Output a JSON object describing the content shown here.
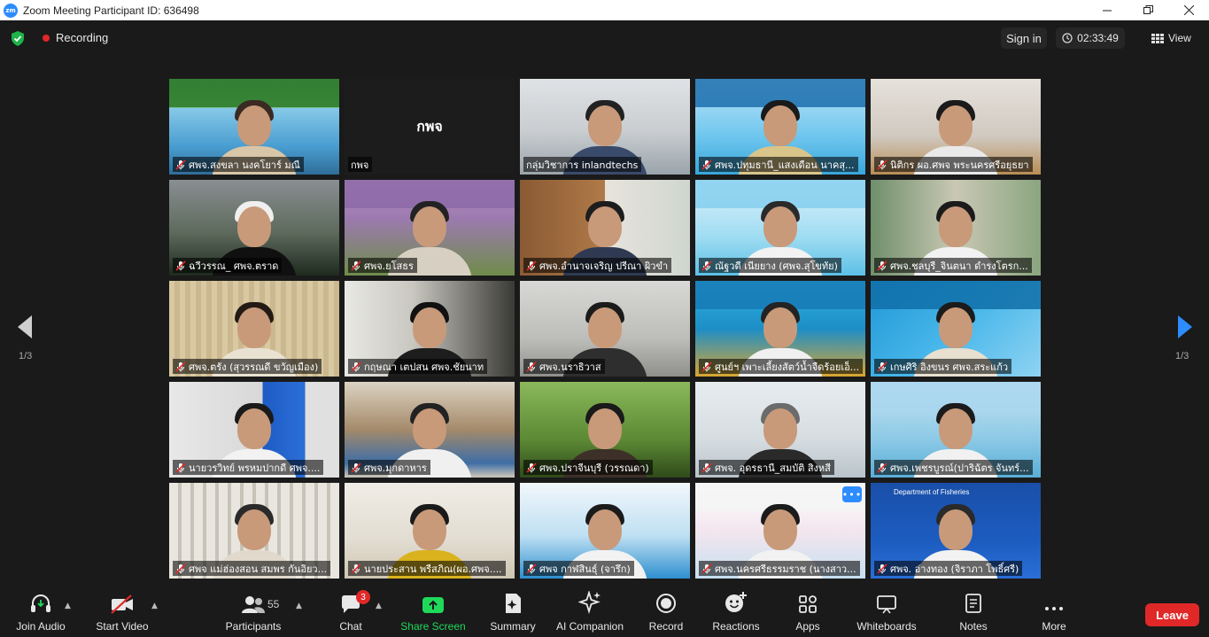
{
  "window": {
    "title": "Zoom Meeting Participant ID: 636498",
    "logo": "zm"
  },
  "topbar": {
    "recording_label": "Recording",
    "sign_in_label": "Sign in",
    "timer": "02:33:49",
    "view_label": "View"
  },
  "gallery": {
    "page_indicator_left": "1/3",
    "page_indicator_right": "1/3",
    "tiles": [
      {
        "name": "ศพจ.สงขลา นงคโยาร์ มณี",
        "muted": true,
        "style": "banner-green"
      },
      {
        "name": "กพจ",
        "muted": false,
        "style": "name-only",
        "center_label": "กพจ"
      },
      {
        "name": "กลุ่มวิชาการ inlandtechs",
        "muted": false,
        "style": "room",
        "active": true
      },
      {
        "name": "ศพจ.ปทุมธานี_แสงเดือน นาคสุ...",
        "muted": true,
        "style": "banner-blue"
      },
      {
        "name": "นิติกร ผอ.ศพจ พระนครศรีอยุธยา",
        "muted": true,
        "style": "man-office"
      },
      {
        "name": "ฉวีวรรณ_ ศพจ.ตราด",
        "muted": true,
        "style": "outdoor-dark"
      },
      {
        "name": "ศพจ.ยโสธร",
        "muted": true,
        "style": "banner-purple"
      },
      {
        "name": "ศพจ.อำนาจเจริญ ปรีณา ผิวขำ",
        "muted": true,
        "style": "office-wood"
      },
      {
        "name": "ณัฐวดี เนียยาง (ศพจ.สุโขทัย)",
        "muted": true,
        "style": "banner-sun"
      },
      {
        "name": "ศพจ.ชลบุรี_จินตนา ดำรงโตรก...",
        "muted": true,
        "style": "blur-green"
      },
      {
        "name": "ศพจ.ตรัง (สุวรรณดี ขวัญเมือง)",
        "muted": true,
        "style": "blinds"
      },
      {
        "name": "กฤษณา เตปสน ศพจ.ชัยนาท",
        "muted": true,
        "style": "dark-room"
      },
      {
        "name": "ศพจ.นราธิวาส",
        "muted": true,
        "style": "blur-grey"
      },
      {
        "name": "ศูนย์ฯ เพาะเลี้ยงสัตว์น้ำจืดร้อยเอ็...",
        "muted": true,
        "style": "banner-teal"
      },
      {
        "name": "เกษศิริ อิงขนร ศพจ.สระแก้ว",
        "muted": true,
        "style": "banner-arrows"
      },
      {
        "name": "นายวรวิทย์ พรหมปากดี ศพจ....",
        "muted": true,
        "style": "blue-curtain"
      },
      {
        "name": "ศพจ.มุกดาหาร",
        "muted": true,
        "style": "big-room"
      },
      {
        "name": "ศพจ.ปราจีนบุรี (วรรณดา)",
        "muted": true,
        "style": "trees"
      },
      {
        "name": "ศพจ. อุดรธานี_สมบัติ สิงหสี",
        "muted": true,
        "style": "blur-light"
      },
      {
        "name": "ศพจ.เพชรบูรณ์(ปาริฉัตร จันทร์...",
        "muted": true,
        "style": "banner-lightblue"
      },
      {
        "name": "ศพจ แม่ฮ่องสอน สมพร กันอิยว...",
        "muted": true,
        "style": "curtain"
      },
      {
        "name": "นายประสาน พรีสภิณ(ผอ.ศพจ....",
        "muted": true,
        "style": "yellow-room"
      },
      {
        "name": "ศพจ กาฬสินธุ์ (จารึก)",
        "muted": true,
        "style": "blue-wave"
      },
      {
        "name": "ศพจ.นครศรีธรรมราช (นางสาว...",
        "muted": true,
        "style": "banner-temple",
        "more": true
      },
      {
        "name": "ศพจ. อ่างทอง (จิราภา โพธิ์ศรี)",
        "muted": true,
        "style": "dof-blue",
        "dof_header": "Department of Fisheries"
      }
    ]
  },
  "toolbar": {
    "join_audio": "Join Audio",
    "start_video": "Start Video",
    "participants": "Participants",
    "participants_count": "55",
    "chat": "Chat",
    "chat_badge": "3",
    "share_screen": "Share Screen",
    "summary": "Summary",
    "ai_companion": "AI Companion",
    "record": "Record",
    "reactions": "Reactions",
    "apps": "Apps",
    "whiteboards": "Whiteboards",
    "notes": "Notes",
    "more": "More",
    "leave": "Leave"
  },
  "colors": {
    "accent": "#2d8cff",
    "leave": "#e02828",
    "share": "#1fd95b",
    "active_speaker": "#e8e15a"
  }
}
